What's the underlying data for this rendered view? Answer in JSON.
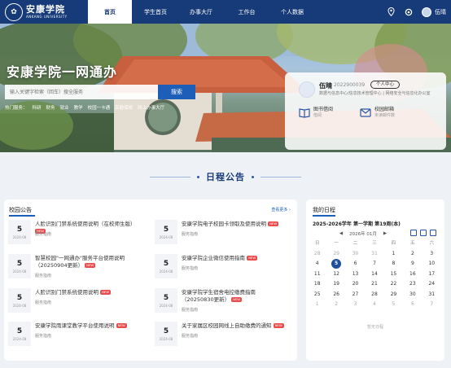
{
  "header": {
    "logo_text": "安康学院",
    "logo_sub": "ANKANG UNIVERSITY",
    "nav": [
      "首页",
      "学生首页",
      "办事大厅",
      "工作台",
      "个人数据"
    ],
    "active_nav": "首页",
    "user_name": "伍晴",
    "icons": [
      "location-pin-icon",
      "settings-icon",
      "avatar"
    ]
  },
  "hero": {
    "title": "安康学院一网通办",
    "search_placeholder": "输入关键字检索（回车）搜全服务",
    "search_button": "搜索",
    "hot_links": [
      "热门服务：",
      "科研",
      "财务",
      "就业",
      "教学",
      "校园一卡通",
      "后勤保修",
      "网上办事大厅"
    ]
  },
  "profile": {
    "name": "伍晴",
    "id": "2022900039",
    "center_button": "个人中心",
    "department": "数据与信息中心/信息技术管理中心  | 网络安全与信息化办公室",
    "tools": [
      {
        "name": "图书借阅",
        "desc": "借阅",
        "icon": "book-icon"
      },
      {
        "name": "校园邮箱",
        "desc": "未读邮件数",
        "icon": "mail-icon"
      }
    ]
  },
  "schedule_heading": "日程公告",
  "notices": {
    "title": "校园公告",
    "more": "查看更多 ",
    "new_badge": "NEW",
    "items": [
      {
        "day": "5",
        "ym": "2024-08",
        "title": "人脸识别门禁系统使用说明（在校师生版）",
        "category": "服务指南",
        "is_new": true
      },
      {
        "day": "5",
        "ym": "2024-08",
        "title": "安康学院电子校园卡领取及使用说明",
        "category": "服务指南",
        "is_new": true
      },
      {
        "day": "5",
        "ym": "2024-08",
        "title": "智慧校园\"一网通办\"服务平台使用说明（20250904更新）",
        "category": "服务指南",
        "is_new": true
      },
      {
        "day": "5",
        "ym": "2024-08",
        "title": "安康学院企业微信使用指南",
        "category": "服务指南",
        "is_new": true
      },
      {
        "day": "5",
        "ym": "2024-08",
        "title": "人脸识别门禁系统使用说明",
        "category": "服务指南",
        "is_new": true
      },
      {
        "day": "5",
        "ym": "2024-08",
        "title": "安康学院学生宿舍电控缴费指南（20250830更新）",
        "category": "服务指南",
        "is_new": true
      },
      {
        "day": "5",
        "ym": "2024-08",
        "title": "安康学院雨课堂教学平台使用说明",
        "category": "服务指南",
        "is_new": true
      },
      {
        "day": "5",
        "ym": "2024-08",
        "title": "关于家属区校园网线上自助缴费的通知",
        "category": "服务指南",
        "is_new": true
      }
    ]
  },
  "calendar": {
    "title": "我的日程",
    "term": "2025-2026学年 第一学期 第19周(本)",
    "month_label": "2026年 01月",
    "prev": "◀",
    "next": "▶",
    "weekdays": [
      "日",
      "一",
      "二",
      "三",
      "四",
      "五",
      "六"
    ],
    "days": [
      {
        "d": "28",
        "m": true
      },
      {
        "d": "29",
        "m": true
      },
      {
        "d": "30",
        "m": true
      },
      {
        "d": "31",
        "m": true
      },
      {
        "d": "1"
      },
      {
        "d": "2"
      },
      {
        "d": "3"
      },
      {
        "d": "4"
      },
      {
        "d": "5",
        "t": true
      },
      {
        "d": "6"
      },
      {
        "d": "7"
      },
      {
        "d": "8"
      },
      {
        "d": "9"
      },
      {
        "d": "10"
      },
      {
        "d": "11"
      },
      {
        "d": "12"
      },
      {
        "d": "13"
      },
      {
        "d": "14"
      },
      {
        "d": "15"
      },
      {
        "d": "16"
      },
      {
        "d": "17"
      },
      {
        "d": "18"
      },
      {
        "d": "19"
      },
      {
        "d": "20"
      },
      {
        "d": "21"
      },
      {
        "d": "22"
      },
      {
        "d": "23"
      },
      {
        "d": "24"
      },
      {
        "d": "25"
      },
      {
        "d": "26"
      },
      {
        "d": "27"
      },
      {
        "d": "28"
      },
      {
        "d": "29"
      },
      {
        "d": "30"
      },
      {
        "d": "31"
      },
      {
        "d": "1",
        "m": true
      },
      {
        "d": "2",
        "m": true
      },
      {
        "d": "3",
        "m": true
      },
      {
        "d": "4",
        "m": true
      },
      {
        "d": "5",
        "m": true
      },
      {
        "d": "6",
        "m": true
      },
      {
        "d": "7",
        "m": true
      }
    ],
    "empty_text": "暂无日程"
  },
  "colors": {
    "primary": "#173a78",
    "accent": "#1d5fb8",
    "new_badge": "#e84c4c"
  }
}
